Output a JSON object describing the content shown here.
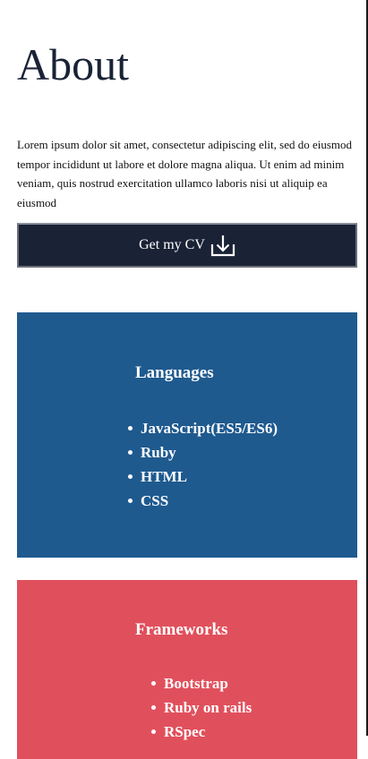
{
  "about": {
    "title": "About",
    "intro": "Lorem ipsum dolor sit amet, consectetur adipiscing elit, sed do eiusmod tempor incididunt ut labore et dolore magna aliqua. Ut enim ad minim veniam, quis nostrud exercitation ullamco laboris nisi ut aliquip ea eiusmod",
    "cv_button": {
      "label": "Get my CV",
      "icon": "download-icon"
    }
  },
  "languages": {
    "title": "Languages",
    "items": [
      "JavaScript(ES5/ES6)",
      "Ruby",
      "HTML",
      "CSS"
    ]
  },
  "frameworks": {
    "title": "Frameworks",
    "items": [
      "Bootstrap",
      "Ruby on rails",
      "RSpec"
    ]
  },
  "colors": {
    "text": "#1a2236",
    "button_bg": "#1a2236",
    "languages_bg": "#1f5a8f",
    "frameworks_bg": "#e0505c"
  }
}
